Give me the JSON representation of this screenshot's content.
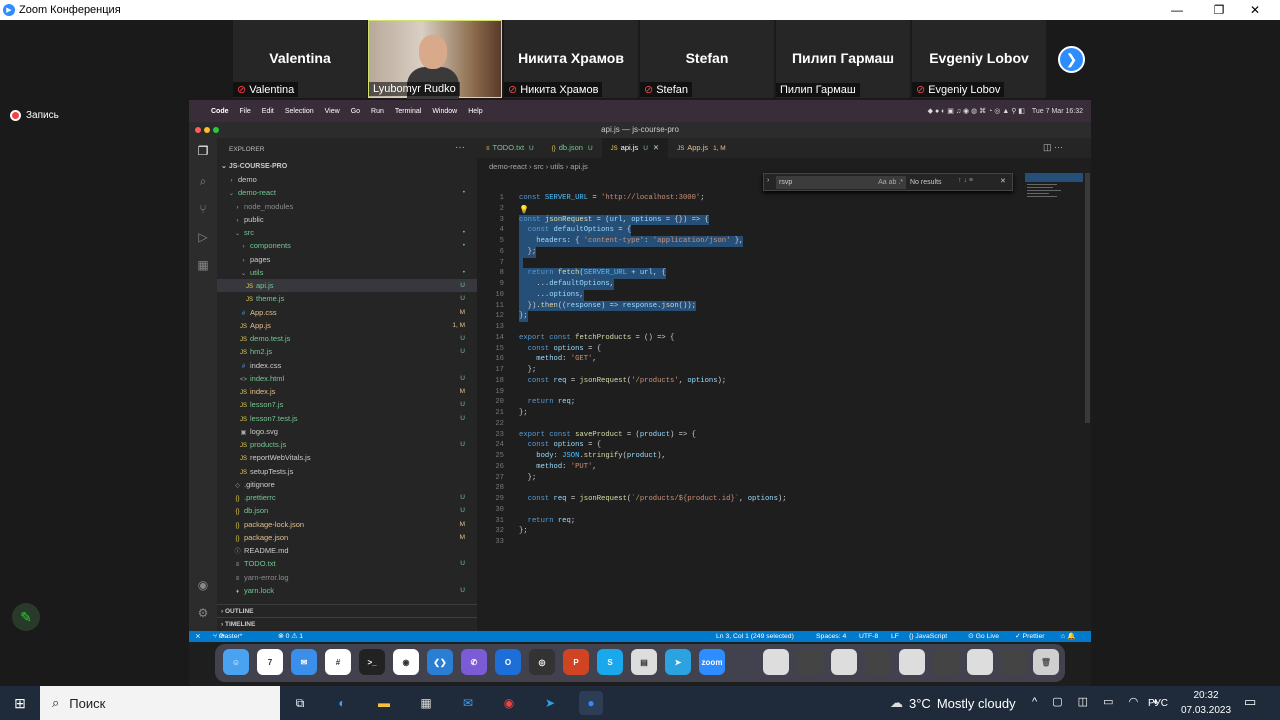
{
  "zoom": {
    "window_title": "Zoom Конференция",
    "minimize": "—",
    "maximize": "❐",
    "close": "✕",
    "participants": [
      {
        "name": "Valentina",
        "label": "Valentina",
        "muted": true
      },
      {
        "name": "",
        "label": "Lyubomyr Rudko",
        "muted": false,
        "video": true
      },
      {
        "name": "Никита Храмов",
        "label": "Никита Храмов",
        "muted": true
      },
      {
        "name": "Stefan",
        "label": "Stefan",
        "muted": true
      },
      {
        "name": "Пилип Гармаш",
        "label": "Пилип Гармаш",
        "muted": false
      },
      {
        "name": "Evgeniy Lobov",
        "label": "Evgeniy Lobov",
        "muted": true
      }
    ],
    "next_icon": "chevron-right-icon",
    "recording_label": "Запись"
  },
  "mac_menu": {
    "items": [
      "Code",
      "File",
      "Edit",
      "Selection",
      "View",
      "Go",
      "Run",
      "Terminal",
      "Window",
      "Help"
    ],
    "datetime": "Tue 7 Mar  16:32"
  },
  "vscode": {
    "title": "api.js — js-course-pro",
    "explorer_header": "EXPLORER",
    "project": "JS-COURSE-PRO",
    "tree": [
      {
        "depth": 0,
        "icon": "›",
        "name": "demo",
        "color": "#ccc",
        "status": ""
      },
      {
        "depth": 0,
        "icon": "⌄",
        "name": "demo-react",
        "color": "#73c991",
        "status": "•"
      },
      {
        "depth": 1,
        "icon": "›",
        "name": "node_modules",
        "color": "#8c8c8c",
        "status": ""
      },
      {
        "depth": 1,
        "icon": "›",
        "name": "public",
        "color": "#ccc",
        "status": ""
      },
      {
        "depth": 1,
        "icon": "⌄",
        "name": "src",
        "color": "#73c991",
        "status": "•"
      },
      {
        "depth": 2,
        "icon": "›",
        "name": "components",
        "color": "#73c991",
        "status": "•"
      },
      {
        "depth": 2,
        "icon": "›",
        "name": "pages",
        "color": "#ccc",
        "status": ""
      },
      {
        "depth": 2,
        "icon": "⌄",
        "name": "utils",
        "color": "#73c991",
        "status": "•"
      },
      {
        "depth": 3,
        "icon": "JS",
        "name": "api.js",
        "color": "#73c991",
        "status": "U",
        "selected": true
      },
      {
        "depth": 3,
        "icon": "JS",
        "name": "theme.js",
        "color": "#73c991",
        "status": "U"
      },
      {
        "depth": 2,
        "icon": "#",
        "name": "App.css",
        "color": "#e2c08d",
        "status": "M"
      },
      {
        "depth": 2,
        "icon": "JS",
        "name": "App.js",
        "color": "#e2c08d",
        "status": "1, M"
      },
      {
        "depth": 2,
        "icon": "JS",
        "name": "demo.test.js",
        "color": "#73c991",
        "status": "U"
      },
      {
        "depth": 2,
        "icon": "JS",
        "name": "hm2.js",
        "color": "#73c991",
        "status": "U"
      },
      {
        "depth": 2,
        "icon": "#",
        "name": "index.css",
        "color": "#ccc",
        "status": ""
      },
      {
        "depth": 2,
        "icon": "<>",
        "name": "index.html",
        "color": "#73c991",
        "status": "U"
      },
      {
        "depth": 2,
        "icon": "JS",
        "name": "index.js",
        "color": "#e2c08d",
        "status": "M"
      },
      {
        "depth": 2,
        "icon": "JS",
        "name": "lesson7.js",
        "color": "#73c991",
        "status": "U"
      },
      {
        "depth": 2,
        "icon": "JS",
        "name": "lesson7.test.js",
        "color": "#73c991",
        "status": "U"
      },
      {
        "depth": 2,
        "icon": "▣",
        "name": "logo.svg",
        "color": "#ccc",
        "status": ""
      },
      {
        "depth": 2,
        "icon": "JS",
        "name": "products.js",
        "color": "#73c991",
        "status": "U"
      },
      {
        "depth": 2,
        "icon": "JS",
        "name": "reportWebVitals.js",
        "color": "#ccc",
        "status": ""
      },
      {
        "depth": 2,
        "icon": "JS",
        "name": "setupTests.js",
        "color": "#ccc",
        "status": ""
      },
      {
        "depth": 1,
        "icon": "◇",
        "name": ".gitignore",
        "color": "#ccc",
        "status": ""
      },
      {
        "depth": 1,
        "icon": "{}",
        "name": ".prettierrc",
        "color": "#73c991",
        "status": "U"
      },
      {
        "depth": 1,
        "icon": "{}",
        "name": "db.json",
        "color": "#73c991",
        "status": "U"
      },
      {
        "depth": 1,
        "icon": "{}",
        "name": "package-lock.json",
        "color": "#e2c08d",
        "status": "M"
      },
      {
        "depth": 1,
        "icon": "{}",
        "name": "package.json",
        "color": "#e2c08d",
        "status": "M"
      },
      {
        "depth": 1,
        "icon": "ⓘ",
        "name": "README.md",
        "color": "#ccc",
        "status": ""
      },
      {
        "depth": 1,
        "icon": "≡",
        "name": "TODO.txt",
        "color": "#73c991",
        "status": "U"
      },
      {
        "depth": 1,
        "icon": "≡",
        "name": "yarn-error.log",
        "color": "#8c8c8c",
        "status": ""
      },
      {
        "depth": 1,
        "icon": "♦",
        "name": "yarn.lock",
        "color": "#73c991",
        "status": "U"
      }
    ],
    "outline_label": "OUTLINE",
    "timeline_label": "TIMELINE",
    "tabs": [
      {
        "label": "TODO.txt",
        "badge": "U",
        "icon": "≡",
        "color": "#73c991"
      },
      {
        "label": "db.json",
        "badge": "U",
        "icon": "{}",
        "color": "#73c991"
      },
      {
        "label": "api.js",
        "badge": "U",
        "icon": "JS",
        "color": "#73c991",
        "active": true
      },
      {
        "label": "App.js",
        "badge": "1, M",
        "icon": "JS",
        "color": "#e2c08d"
      }
    ],
    "breadcrumb": [
      "demo-react",
      "src",
      "utils",
      "api.js"
    ],
    "find": {
      "query": "rsvp",
      "result": "No results",
      "case": "Aa",
      "word": "ab",
      "regex": ".*"
    },
    "code_lines": [
      "const SERVER_URL = 'http://localhost:3000';",
      "",
      "const jsonRequest = (url, options = {}) => {",
      "  const defaultOptions = {",
      "    headers: { 'content-type': 'application/json' },",
      "  };",
      "",
      "  return fetch(SERVER_URL + url, {",
      "    ...defaultOptions,",
      "    ...options,",
      "  }).then((response) => response.json());",
      "};",
      "",
      "export const fetchProducts = () => {",
      "  const options = {",
      "    method: 'GET',",
      "  };",
      "  const req = jsonRequest('/products', options);",
      "",
      "  return req;",
      "};",
      "",
      "export const saveProduct = (product) => {",
      "  const options = {",
      "    body: JSON.stringify(product),",
      "    method: 'PUT',",
      "  };",
      "",
      "  const req = jsonRequest(`/products/${product.id}`, options);",
      "",
      "  return req;",
      "};",
      ""
    ],
    "selected_lines": [
      3,
      4,
      5,
      6,
      7,
      8,
      9,
      10,
      11,
      12
    ],
    "status": {
      "branch": "master*",
      "problems": "⊗ 0 ⚠ 1",
      "cursor": "Ln 3, Col 1 (249 selected)",
      "spaces": "Spaces: 4",
      "encoding": "UTF-8",
      "eol": "LF",
      "language": "{} JavaScript",
      "golive": "⊙ Go Live",
      "prettier": "✓ Prettier"
    }
  },
  "dock_apps": [
    {
      "name": "finder",
      "label": "☺",
      "color": "#4aa3f0"
    },
    {
      "name": "calendar",
      "label": "7",
      "color": "#ffffff"
    },
    {
      "name": "mail",
      "label": "✉",
      "color": "#3b8eea"
    },
    {
      "name": "slack",
      "label": "#",
      "color": "#ffffff"
    },
    {
      "name": "terminal",
      "label": ">_",
      "color": "#222222"
    },
    {
      "name": "chrome",
      "label": "◉",
      "color": "#ffffff"
    },
    {
      "name": "vscode",
      "label": "❮❯",
      "color": "#2a7fd4"
    },
    {
      "name": "viber",
      "label": "✆",
      "color": "#7b5cd6"
    },
    {
      "name": "outlook",
      "label": "O",
      "color": "#1d6ed6"
    },
    {
      "name": "obs",
      "label": "◎",
      "color": "#333333"
    },
    {
      "name": "powerpoint",
      "label": "P",
      "color": "#d04423"
    },
    {
      "name": "skype",
      "label": "S",
      "color": "#1aa7ec"
    },
    {
      "name": "preview",
      "label": "▤",
      "color": "#dddddd"
    },
    {
      "name": "telegram",
      "label": "➤",
      "color": "#2aa3e0"
    },
    {
      "name": "zoom",
      "label": "zoom",
      "color": "#2d8cff"
    }
  ],
  "taskbar": {
    "search_placeholder": "Поиск",
    "weather_temp": "3°C",
    "weather_text": "Mostly cloudy",
    "lang": "РУС",
    "time": "20:32",
    "date": "07.03.2023"
  }
}
